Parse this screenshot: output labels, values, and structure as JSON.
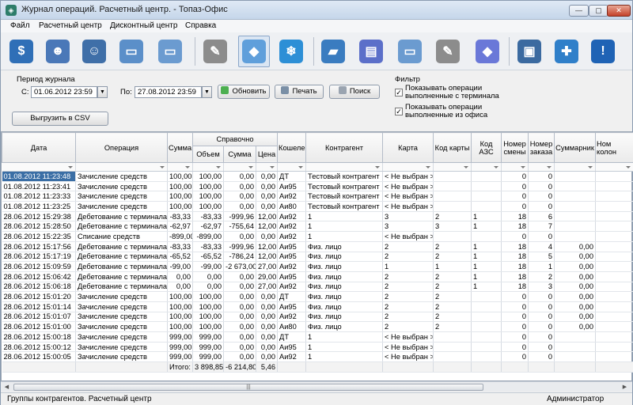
{
  "window": {
    "title": "Журнал операций. Расчетный центр. - Топаз-Офис"
  },
  "menu": [
    "Файл",
    "Расчетный центр",
    "Дисконтный центр",
    "Справка"
  ],
  "toolbar": {
    "icons": [
      {
        "name": "money-bag-icon",
        "color": "#2f6fb7",
        "glyph": "$"
      },
      {
        "name": "users-group-icon",
        "color": "#4a78b8",
        "glyph": "☻"
      },
      {
        "name": "users-pair-icon",
        "color": "#3f6fa8",
        "glyph": "☺"
      },
      {
        "name": "card-stack-icon",
        "color": "#5b8fc9",
        "glyph": "▭"
      },
      {
        "name": "cards-icon",
        "color": "#6b9bd0",
        "glyph": "▭"
      },
      {
        "name": "notepad-edit-icon",
        "color": "#8c8c8c",
        "glyph": "✎"
      },
      {
        "name": "journal-icon",
        "color": "#5f9fdb",
        "glyph": "◆"
      },
      {
        "name": "snowflake-icon",
        "color": "#2d8fd6",
        "glyph": "❄"
      },
      {
        "name": "card-transfer-icon",
        "color": "#3a7cc0",
        "glyph": "▰"
      },
      {
        "name": "card-stack-2-icon",
        "color": "#5b6fc9",
        "glyph": "▤"
      },
      {
        "name": "cards-2-icon",
        "color": "#6b9bd0",
        "glyph": "▭"
      },
      {
        "name": "notepad-icon",
        "color": "#8c8c8c",
        "glyph": "✎"
      },
      {
        "name": "card-blue-icon",
        "color": "#6a78d8",
        "glyph": "◆"
      },
      {
        "name": "book-icon",
        "color": "#3b6aa0",
        "glyph": "▣"
      },
      {
        "name": "puzzle-icon",
        "color": "#2f7fc9",
        "glyph": "✚"
      },
      {
        "name": "exclamation-icon",
        "color": "#1f63b5",
        "glyph": "!"
      }
    ]
  },
  "period": {
    "title": "Период журнала",
    "from_label": "С:",
    "from_value": "01.06.2012 23:59",
    "to_label": "По:",
    "to_value": "27.08.2012 23:59",
    "refresh_label": "Обновить",
    "print_label": "Печать",
    "search_label": "Поиск",
    "export_label": "Выгрузить в CSV"
  },
  "filter": {
    "title": "Фильтр",
    "terminal_line1": "Показывать операции",
    "terminal_line2": "выполненные с терминала",
    "office_line1": "Показывать операции",
    "office_line2": "выполненные из офиса",
    "terminal_checked": true,
    "office_checked": true
  },
  "grid": {
    "headers": {
      "date": "Дата",
      "operation": "Операция",
      "sum": "Сумма",
      "reference": "Справочно",
      "volume": "Объем",
      "ref_sum": "Сумма",
      "price": "Цена",
      "wallet": "Кошелек",
      "contractor": "Контрагент",
      "card": "Карта",
      "card_code": "Код карты",
      "station_code": "Код АЗС",
      "shift_line1": "Номер",
      "shift_line2": "смены",
      "order_line1": "Номер",
      "order_line2": "заказа",
      "total_col": "Суммарник",
      "last_line1": "Ном",
      "last_line2": "колон"
    },
    "rows": [
      [
        "01.08.2012 11:23:48",
        "Зачисление средств",
        "100,00",
        "100,00",
        "0,00",
        "0,00",
        "ДТ",
        "Тестовый контрагент",
        "< Не выбран >",
        "",
        "",
        "0",
        "0",
        "",
        ""
      ],
      [
        "01.08.2012 11:23:41",
        "Зачисление средств",
        "100,00",
        "100,00",
        "0,00",
        "0,00",
        "Аи95",
        "Тестовый контрагент",
        "< Не выбран >",
        "",
        "",
        "0",
        "0",
        "",
        ""
      ],
      [
        "01.08.2012 11:23:33",
        "Зачисление средств",
        "100,00",
        "100,00",
        "0,00",
        "0,00",
        "Аи92",
        "Тестовый контрагент",
        "< Не выбран >",
        "",
        "",
        "0",
        "0",
        "",
        ""
      ],
      [
        "01.08.2012 11:23:25",
        "Зачисление средств",
        "100,00",
        "100,00",
        "0,00",
        "0,00",
        "Аи80",
        "Тестовый контрагент",
        "< Не выбран >",
        "",
        "",
        "0",
        "0",
        "",
        ""
      ],
      [
        "28.06.2012 15:29:38",
        "Дебетование с терминала",
        "-83,33",
        "-83,33",
        "-999,96",
        "12,00",
        "Аи92",
        "1",
        "3",
        "2",
        "1",
        "18",
        "6",
        "",
        ""
      ],
      [
        "28.06.2012 15:28:50",
        "Дебетование с терминала",
        "-62,97",
        "-62,97",
        "-755,64",
        "12,00",
        "Аи92",
        "1",
        "3",
        "3",
        "1",
        "18",
        "7",
        "",
        ""
      ],
      [
        "28.06.2012 15:22:35",
        "Списание средств",
        "-899,00",
        "-899,00",
        "0,00",
        "0,00",
        "Аи92",
        "1",
        "< Не выбран >",
        "",
        "",
        "0",
        "0",
        "",
        ""
      ],
      [
        "28.06.2012 15:17:56",
        "Дебетование с терминала",
        "-83,33",
        "-83,33",
        "-999,96",
        "12,00",
        "Аи95",
        "Физ. лицо",
        "2",
        "2",
        "1",
        "18",
        "4",
        "0,00",
        ""
      ],
      [
        "28.06.2012 15:17:19",
        "Дебетование с терминала",
        "-65,52",
        "-65,52",
        "-786,24",
        "12,00",
        "Аи95",
        "Физ. лицо",
        "2",
        "2",
        "1",
        "18",
        "5",
        "0,00",
        ""
      ],
      [
        "28.06.2012 15:09:59",
        "Дебетование с терминала",
        "-99,00",
        "-99,00",
        "-2 673,00",
        "27,00",
        "Аи92",
        "Физ. лицо",
        "1",
        "1",
        "1",
        "18",
        "1",
        "0,00",
        ""
      ],
      [
        "28.06.2012 15:06:42",
        "Дебетование с терминала",
        "0,00",
        "0,00",
        "0,00",
        "29,00",
        "Аи95",
        "Физ. лицо",
        "2",
        "2",
        "1",
        "18",
        "2",
        "0,00",
        ""
      ],
      [
        "28.06.2012 15:06:18",
        "Дебетование с терминала",
        "0,00",
        "0,00",
        "0,00",
        "27,00",
        "Аи92",
        "Физ. лицо",
        "2",
        "2",
        "1",
        "18",
        "3",
        "0,00",
        ""
      ],
      [
        "28.06.2012 15:01:20",
        "Зачисление средств",
        "100,00",
        "100,00",
        "0,00",
        "0,00",
        "ДТ",
        "Физ. лицо",
        "2",
        "2",
        "",
        "0",
        "0",
        "0,00",
        ""
      ],
      [
        "28.06.2012 15:01:14",
        "Зачисление средств",
        "100,00",
        "100,00",
        "0,00",
        "0,00",
        "Аи95",
        "Физ. лицо",
        "2",
        "2",
        "",
        "0",
        "0",
        "0,00",
        ""
      ],
      [
        "28.06.2012 15:01:07",
        "Зачисление средств",
        "100,00",
        "100,00",
        "0,00",
        "0,00",
        "Аи92",
        "Физ. лицо",
        "2",
        "2",
        "",
        "0",
        "0",
        "0,00",
        ""
      ],
      [
        "28.06.2012 15:01:00",
        "Зачисление средств",
        "100,00",
        "100,00",
        "0,00",
        "0,00",
        "Аи80",
        "Физ. лицо",
        "2",
        "2",
        "",
        "0",
        "0",
        "0,00",
        ""
      ],
      [
        "28.06.2012 15:00:18",
        "Зачисление средств",
        "999,00",
        "999,00",
        "0,00",
        "0,00",
        "ДТ",
        "1",
        "< Не выбран >",
        "",
        "",
        "0",
        "0",
        "",
        ""
      ],
      [
        "28.06.2012 15:00:12",
        "Зачисление средств",
        "999,00",
        "999,00",
        "0,00",
        "0,00",
        "Аи95",
        "1",
        "< Не выбран >",
        "",
        "",
        "0",
        "0",
        "",
        ""
      ],
      [
        "28.06.2012 15:00:05",
        "Зачисление средств",
        "999,00",
        "999,00",
        "0,00",
        "0,00",
        "Аи92",
        "1",
        "< Не выбран >",
        "",
        "",
        "0",
        "0",
        "",
        ""
      ]
    ],
    "totals": {
      "label": "Итого:",
      "volume": "3 898,85",
      "sum": "-6 214,80",
      "price": "5,46"
    }
  },
  "statusbar": {
    "left": "Группы контрагентов. Расчетный центр",
    "right": "Администратор"
  }
}
